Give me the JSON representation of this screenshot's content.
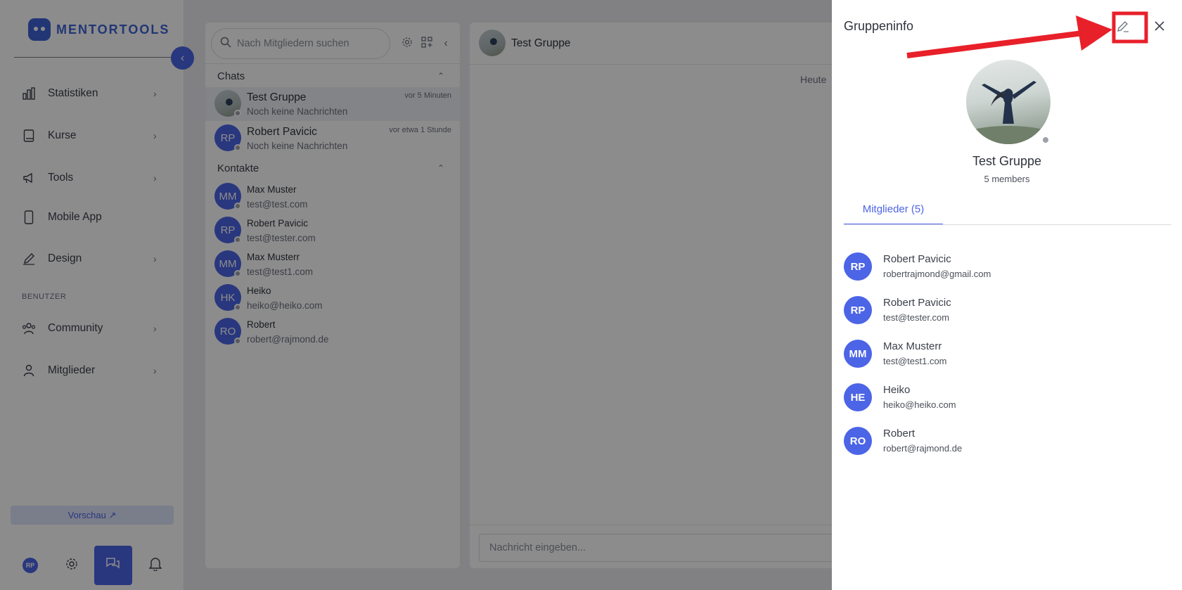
{
  "sidebar": {
    "logo_text": "MENTORTOOLS",
    "collapse_icon": "chevron-left-icon",
    "nav_items": [
      {
        "label": "Statistiken",
        "icon": "bar-chart-icon",
        "has_chevron": true
      },
      {
        "label": "Kurse",
        "icon": "book-icon",
        "has_chevron": true
      },
      {
        "label": "Tools",
        "icon": "megaphone-icon",
        "has_chevron": true
      },
      {
        "label": "Mobile App",
        "icon": "smartphone-icon",
        "has_chevron": false
      },
      {
        "label": "Design",
        "icon": "pencil-icon",
        "has_chevron": true
      }
    ],
    "section_label": "BENUTZER",
    "user_items": [
      {
        "label": "Community",
        "icon": "users-icon",
        "has_chevron": true
      },
      {
        "label": "Mitglieder",
        "icon": "user-icon",
        "has_chevron": true
      }
    ],
    "preview_label": "Vorschau ↗",
    "bottom": {
      "avatar_initials": "RP"
    }
  },
  "chatlist": {
    "search_placeholder": "Nach Mitgliedern suchen",
    "chats_label": "Chats",
    "contacts_label": "Kontakte",
    "chats": [
      {
        "title": "Test Gruppe",
        "subtitle": "Noch keine Nachrichten",
        "time": "vor 5 Minuten",
        "initials": ""
      },
      {
        "title": "Robert Pavicic",
        "subtitle": "Noch keine Nachrichten",
        "time": "vor etwa 1 Stunde",
        "initials": "RP"
      }
    ],
    "contacts": [
      {
        "initials": "MM",
        "name": "Max Muster",
        "email": "test@test.com"
      },
      {
        "initials": "RP",
        "name": "Robert Pavicic",
        "email": "test@tester.com"
      },
      {
        "initials": "MM",
        "name": "Max Musterr",
        "email": "test@test1.com"
      },
      {
        "initials": "HK",
        "name": "Heiko",
        "email": "heiko@heiko.com"
      },
      {
        "initials": "RO",
        "name": "Robert",
        "email": "robert@rajmond.de"
      }
    ]
  },
  "chatpane": {
    "title": "Test Gruppe",
    "date_label": "Heute",
    "input_placeholder": "Nachricht eingeben..."
  },
  "drawer": {
    "title": "Gruppeninfo",
    "group_name": "Test Gruppe",
    "member_count": "5 members",
    "tab_label": "Mitglieder (5)",
    "members": [
      {
        "initials": "RP",
        "name": "Robert Pavicic",
        "email": "robertrajmond@gmail.com"
      },
      {
        "initials": "RP",
        "name": "Robert Pavicic",
        "email": "test@tester.com"
      },
      {
        "initials": "MM",
        "name": "Max Musterr",
        "email": "test@test1.com"
      },
      {
        "initials": "HE",
        "name": "Heiko",
        "email": "heiko@heiko.com"
      },
      {
        "initials": "RO",
        "name": "Robert",
        "email": "robert@rajmond.de"
      }
    ]
  },
  "colors": {
    "accent": "#4c64e6",
    "annotation": "#e8202a"
  }
}
